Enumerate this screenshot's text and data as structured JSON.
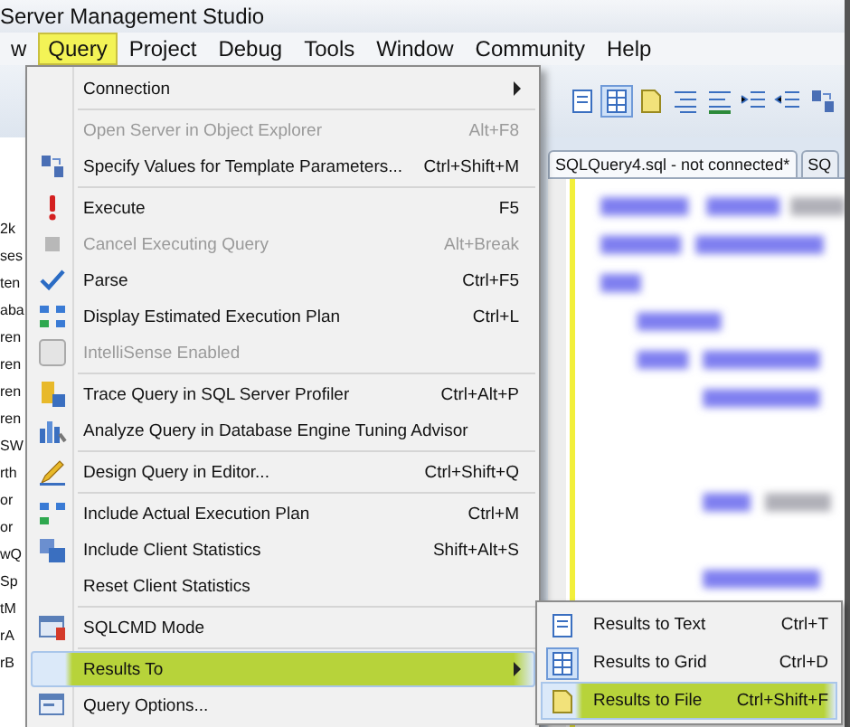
{
  "window": {
    "title": "Server Management Studio"
  },
  "menu_bar": [
    {
      "label": "w",
      "selected": false
    },
    {
      "label": "Query",
      "selected": true
    },
    {
      "label": "Project",
      "selected": false
    },
    {
      "label": "Debug",
      "selected": false
    },
    {
      "label": "Tools",
      "selected": false
    },
    {
      "label": "Window",
      "selected": false
    },
    {
      "label": "Community",
      "selected": false
    },
    {
      "label": "Help",
      "selected": false
    }
  ],
  "object_explorer": {
    "fragments": [
      "2k",
      "ses",
      "ten",
      "aba",
      "ren",
      "ren",
      "ren",
      "ren",
      "SW",
      "rth",
      "or",
      "or",
      "wQ",
      "Sp",
      "tM",
      "rA",
      "rB"
    ]
  },
  "editor_tabs": [
    {
      "label": "SQLQuery4.sql - not connected*",
      "selected": true
    },
    {
      "label": "SQ",
      "selected": false
    }
  ],
  "query_menu": [
    {
      "label": "Connection",
      "submenu": true,
      "disabled": false,
      "selected": false,
      "separator_after": true
    },
    {
      "label": "Open Server in Object Explorer",
      "shortcut": "Alt+F8",
      "disabled": true,
      "selected": false
    },
    {
      "label": "Specify Values for Template Parameters...",
      "shortcut": "Ctrl+Shift+M",
      "disabled": false,
      "selected": false,
      "separator_after": true
    },
    {
      "label": "Execute",
      "shortcut": "F5",
      "disabled": false,
      "selected": false
    },
    {
      "label": "Cancel Executing Query",
      "shortcut": "Alt+Break",
      "disabled": true,
      "selected": false
    },
    {
      "label": "Parse",
      "shortcut": "Ctrl+F5",
      "disabled": false,
      "selected": false
    },
    {
      "label": "Display Estimated Execution Plan",
      "shortcut": "Ctrl+L",
      "disabled": false,
      "selected": false
    },
    {
      "label": "IntelliSense Enabled",
      "disabled": true,
      "selected": false,
      "separator_after": true
    },
    {
      "label": "Trace Query in SQL Server Profiler",
      "shortcut": "Ctrl+Alt+P",
      "disabled": false,
      "selected": false
    },
    {
      "label": "Analyze Query in Database Engine Tuning Advisor",
      "disabled": false,
      "selected": false,
      "separator_after": true
    },
    {
      "label": "Design Query in Editor...",
      "shortcut": "Ctrl+Shift+Q",
      "disabled": false,
      "selected": false,
      "separator_after": true
    },
    {
      "label": "Include Actual Execution Plan",
      "shortcut": "Ctrl+M",
      "disabled": false,
      "selected": false
    },
    {
      "label": "Include Client Statistics",
      "shortcut": "Shift+Alt+S",
      "disabled": false,
      "selected": false
    },
    {
      "label": "Reset Client Statistics",
      "disabled": false,
      "selected": false,
      "separator_after": true
    },
    {
      "label": "SQLCMD Mode",
      "disabled": false,
      "selected": false,
      "separator_after": true
    },
    {
      "label": "Results To",
      "submenu": true,
      "disabled": false,
      "selected": true
    },
    {
      "label": "Query Options...",
      "disabled": false,
      "selected": false
    }
  ],
  "results_to_submenu": [
    {
      "label": "Results to Text",
      "shortcut": "Ctrl+T",
      "checked": false,
      "selected": false
    },
    {
      "label": "Results to Grid",
      "shortcut": "Ctrl+D",
      "checked": true,
      "selected": false
    },
    {
      "label": "Results to File",
      "shortcut": "Ctrl+Shift+F",
      "checked": false,
      "selected": true
    }
  ]
}
